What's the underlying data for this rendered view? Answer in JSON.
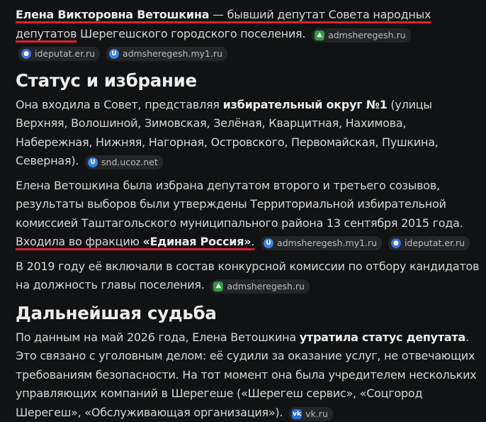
{
  "intro": {
    "name": "Елена Викторовна Ветошкина",
    "text1": " — бывший депутат Совета народных депутатов",
    "text2": " Шерегешского городского поселения.",
    "sources": [
      "admsheregesh.ru",
      "ideputat.er.ru",
      "admsheregesh.my1.ru"
    ]
  },
  "section1": {
    "heading": "Статус и избрание",
    "p1": {
      "pre": "Она входила в Совет, представляя ",
      "bold": "избирательный округ №1",
      "post": " (улицы Верхняя, Волошиной, Зимовская, Зелёная, Кварцитная, Нахимова, Набережная, Нижняя, Нагорная, Островского, Первомайская, Пушкина, Северная).",
      "source": "snd.ucoz.net"
    },
    "p2": {
      "text": "Елена Ветошкина была избрана депутатом второго и третьего созывов, результаты выборов были утверждены Территориальной избирательной комиссией Таштагольского муниципального района 13 сентября 2015 года. ",
      "ul_pre": "Входила во фракцию ",
      "ul_bold": "«Единая Россия»",
      "ul_post": ".",
      "sources": [
        "admsheregesh.my1.ru",
        "ideputat.er.ru"
      ]
    },
    "p3": {
      "text": "В 2019 году её включали в состав конкурсной комиссии по отбору кандидатов на должность главы поселения.",
      "source": "admsheregesh.ru"
    }
  },
  "section2": {
    "heading": "Дальнейшая судьба",
    "p1": {
      "pre": "По данным на май 2026 года, Елена Ветошкина ",
      "bold": "утратила статус депутата",
      "post": ". Это связано с уголовным делом: её судили за оказание услуг, не отвечающих требованиям безопасности. На тот момент она была учредителем нескольких управляющих компаний в Шерегеше («Шерегеш сервис», «Соцгород Шерегеш», «Обслуживающая организация»).",
      "source": "vk.ru"
    }
  },
  "icons": {
    "admsheregesh.ru": "green-emblem-icon",
    "ideputat.er.ru": "er-bear-icon",
    "admsheregesh.my1.ru": "ucoz-u-icon",
    "snd.ucoz.net": "ucoz-u-icon",
    "vk.ru": "vk-icon"
  }
}
